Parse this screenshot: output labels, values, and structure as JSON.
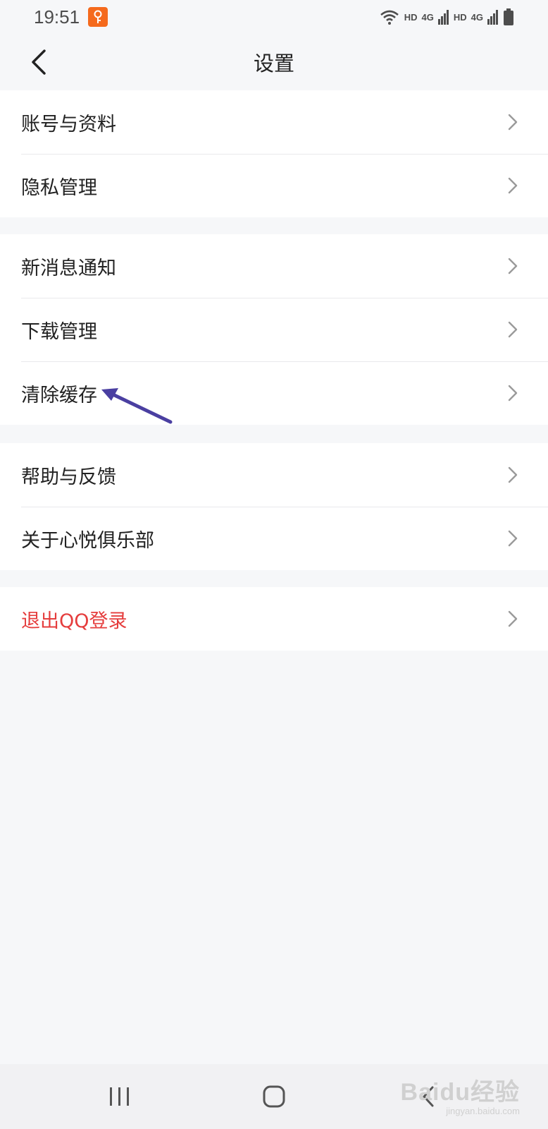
{
  "status_bar": {
    "time": "19:51",
    "badge_icon": "key-notification-icon",
    "net1": "HD",
    "sig1": "4G",
    "net2": "HD",
    "sig2": "4G"
  },
  "header": {
    "title": "设置",
    "back_icon": "back-arrow-icon"
  },
  "groups": [
    {
      "items": [
        {
          "label": "账号与资料"
        },
        {
          "label": "隐私管理"
        }
      ]
    },
    {
      "items": [
        {
          "label": "新消息通知"
        },
        {
          "label": "下载管理"
        },
        {
          "label": "清除缓存"
        }
      ]
    },
    {
      "items": [
        {
          "label": "帮助与反馈"
        },
        {
          "label": "关于心悦俱乐部"
        }
      ]
    },
    {
      "items": [
        {
          "label": "退出QQ登录",
          "danger": true
        }
      ]
    }
  ],
  "annotation": {
    "target": "清除缓存",
    "color": "#4a3fa1"
  },
  "colors": {
    "danger": "#e53d3d",
    "background": "#f6f7f9",
    "badge": "#f56a1d"
  },
  "watermark": {
    "main": "Baidu经验",
    "sub": "jingyan.baidu.com"
  }
}
